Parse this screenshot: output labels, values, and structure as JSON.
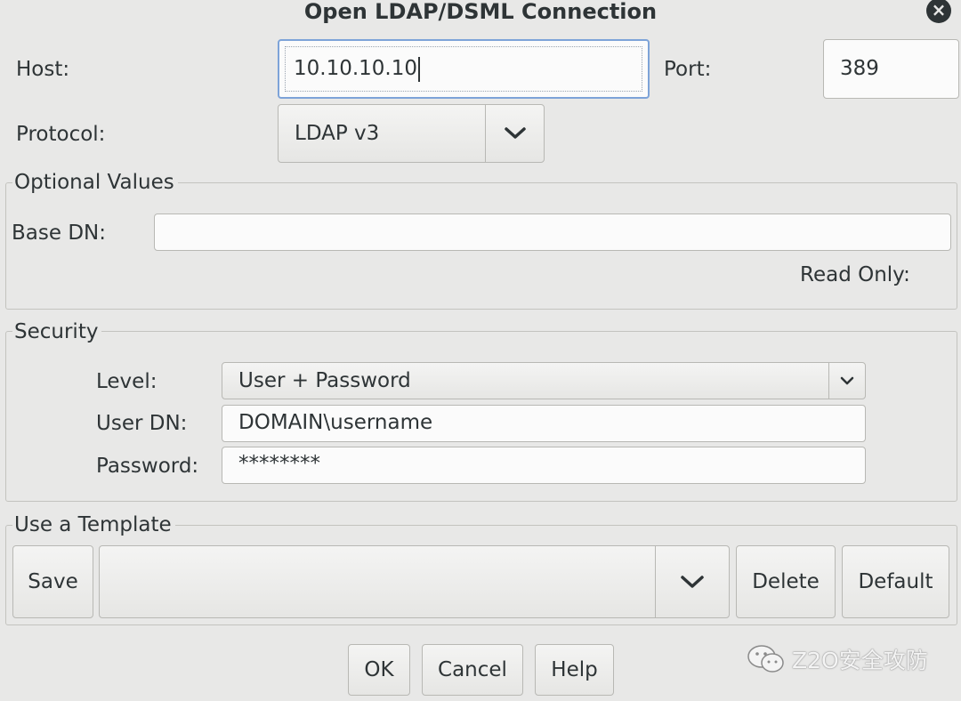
{
  "dialog": {
    "title": "Open LDAP/DSML Connection",
    "close_icon": "close-icon"
  },
  "connection": {
    "host_label": "Host:",
    "host_value": "10.10.10.10",
    "port_label": "Port:",
    "port_value": "389",
    "protocol_label": "Protocol:",
    "protocol_value": "LDAP v3"
  },
  "optional_values": {
    "legend": "Optional Values",
    "base_dn_label": "Base DN:",
    "base_dn_value": "",
    "read_only_label": "Read Only:"
  },
  "security": {
    "legend": "Security",
    "level_label": "Level:",
    "level_value": "User + Password",
    "user_dn_label": "User DN:",
    "user_dn_value": "DOMAIN\\username",
    "password_label": "Password:",
    "password_value": "********"
  },
  "template": {
    "legend": "Use a Template",
    "save_label": "Save",
    "selected_value": "",
    "delete_label": "Delete",
    "default_label": "Default"
  },
  "buttons": {
    "ok": "OK",
    "cancel": "Cancel",
    "help": "Help"
  },
  "watermark": {
    "text": "Z2O安全攻防",
    "icon": "wechat-icon"
  }
}
